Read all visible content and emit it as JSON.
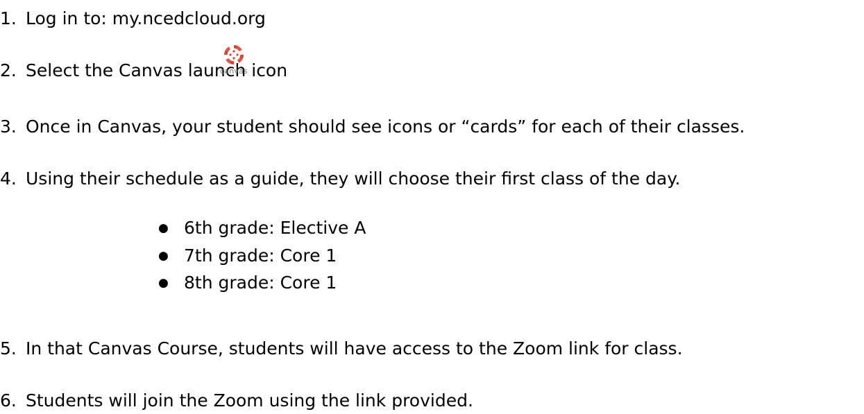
{
  "steps": [
    {
      "number": "1.",
      "text": "Log in to: my.ncedcloud.org"
    },
    {
      "number": "2.",
      "text": "Select the Canvas launch icon"
    },
    {
      "number": "3.",
      "text": "Once in Canvas, your student should see icons or “cards” for each of their classes."
    },
    {
      "number": "4.",
      "text": "Using their schedule as a guide, they will choose their first class of the day."
    },
    {
      "number": "5.",
      "text": "In that Canvas Course, students will have access to the Zoom link for class."
    },
    {
      "number": "6.",
      "text": "Students will join the Zoom using the link provided."
    }
  ],
  "bullet_symbol": "●",
  "grades": [
    "6th grade: Elective A",
    "7th grade: Core 1",
    "8th grade: Core 1"
  ],
  "canvas_icon": {
    "icon": "canvas-logo-icon",
    "label": "canvas",
    "color": "#e23f2b"
  }
}
